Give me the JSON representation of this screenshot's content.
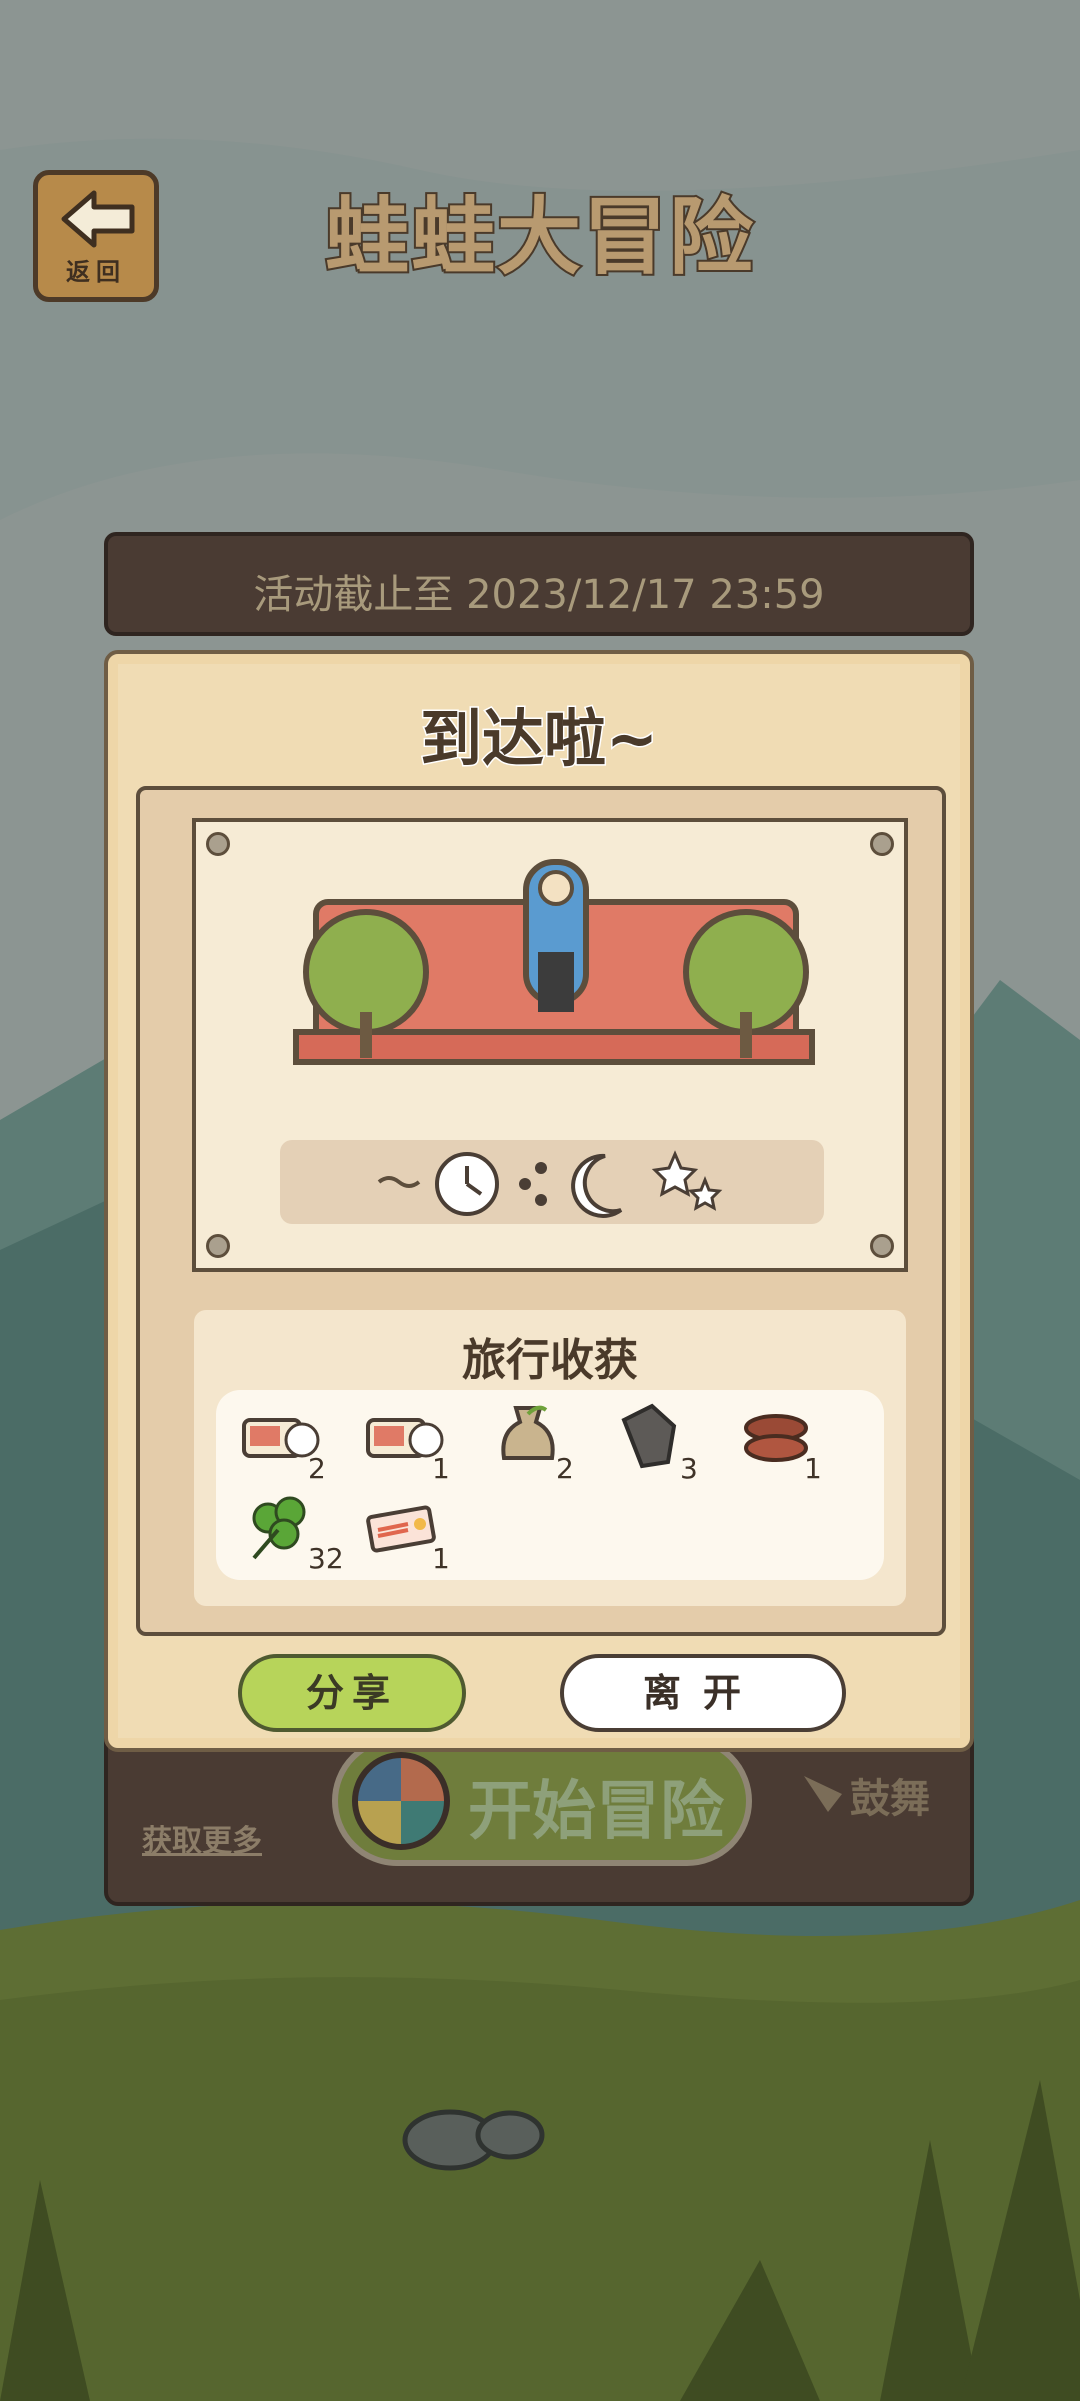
{
  "header": {
    "back_label": "返回",
    "title": "蛙蛙大冒险"
  },
  "deadline": {
    "text": "活动截止至 2023/12/17 23:59"
  },
  "popup": {
    "title": "到达啦~",
    "status_icons": [
      "dash-icon",
      "clock-icon",
      "footprints-icon",
      "moon-icon",
      "stars-icon"
    ],
    "harvest": {
      "title": "旅行收获",
      "items": [
        {
          "icon": "postcard-ticket-icon",
          "count": "2"
        },
        {
          "icon": "postcard-ticket-icon",
          "count": "1"
        },
        {
          "icon": "seed-bag-icon",
          "count": "2"
        },
        {
          "icon": "rock-icon",
          "count": "3"
        },
        {
          "icon": "wood-log-icon",
          "count": "1"
        },
        {
          "icon": "clover-icon",
          "count": "32"
        },
        {
          "icon": "ticket-icon",
          "count": "1"
        }
      ]
    },
    "share_label": "分享",
    "leave_label": "离开"
  },
  "background_board": {
    "get_more_label": "获取更多",
    "start_label": "开始冒险",
    "cheer_label": "鼓舞"
  },
  "colors": {
    "accent_green": "#b7d45a",
    "wood_dark": "#4a3b33",
    "panel_cream": "#f0dcb4"
  }
}
